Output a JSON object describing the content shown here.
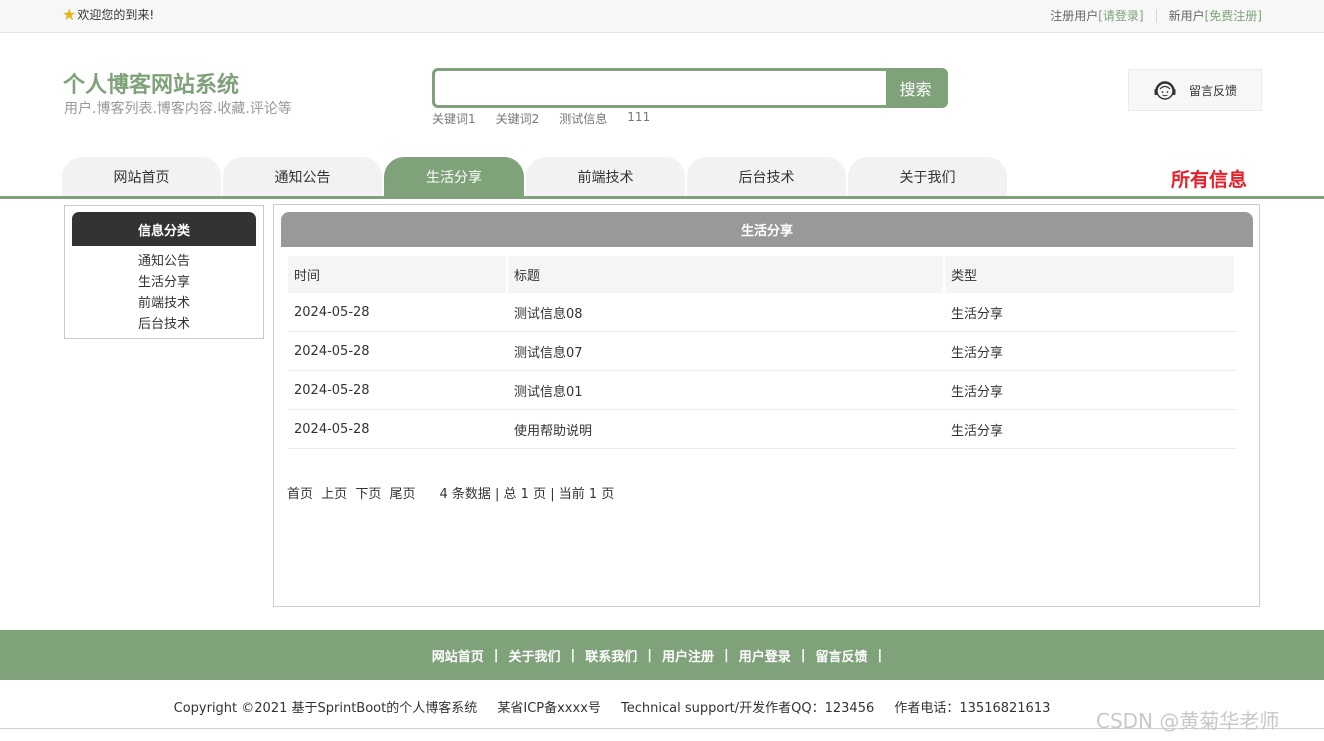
{
  "topbar": {
    "welcome": "欢迎您的到来!",
    "login_prefix": "注册用户 ",
    "login_link": "[请登录]",
    "register_prefix": "新用户 ",
    "register_link": "[免费注册]"
  },
  "header": {
    "title": "个人博客网站系统",
    "subtitle": "用户.博客列表.博客内容.收藏.评论等",
    "search_placeholder": "",
    "search_button": "搜索",
    "keywords": [
      "关键词1",
      "关键词2",
      "测试信息",
      "111"
    ],
    "feedback_label": "留言反馈"
  },
  "nav": {
    "items": [
      "网站首页",
      "通知公告",
      "生活分享",
      "前端技术",
      "后台技术",
      "关于我们"
    ],
    "active_index": 2,
    "right_label": "所有信息"
  },
  "sidebar": {
    "title": "信息分类",
    "items": [
      "通知公告",
      "生活分享",
      "前端技术",
      "后台技术"
    ]
  },
  "main": {
    "title": "生活分享",
    "columns": [
      "时间",
      "标题",
      "类型"
    ],
    "rows": [
      {
        "time": "2024-05-28",
        "title": "测试信息08",
        "type": "生活分享"
      },
      {
        "time": "2024-05-28",
        "title": "测试信息07",
        "type": "生活分享"
      },
      {
        "time": "2024-05-28",
        "title": "测试信息01",
        "type": "生活分享"
      },
      {
        "time": "2024-05-28",
        "title": "使用帮助说明",
        "type": "生活分享"
      }
    ],
    "pager": {
      "first": "首页",
      "prev": "上页",
      "next": "下页",
      "last": "尾页",
      "info": "4 条数据 | 总 1 页 | 当前 1 页"
    }
  },
  "footer": {
    "links": [
      "网站首页",
      "关于我们",
      "联系我们",
      "用户注册",
      "用户登录",
      "留言反馈"
    ],
    "separator": "|",
    "copyright": "Copyright ©2021 基于SprintBoot的个人博客系统",
    "icp": "某省ICP备xxxx号",
    "support": "Technical support/开发作者QQ：123456",
    "phone": "作者电话：13516821613"
  },
  "watermark": "CSDN @黄菊华老师",
  "colors": {
    "accent": "#7fa27b",
    "dark_header": "#333333",
    "gray_header": "#999999",
    "highlight_red": "#e5202b"
  }
}
